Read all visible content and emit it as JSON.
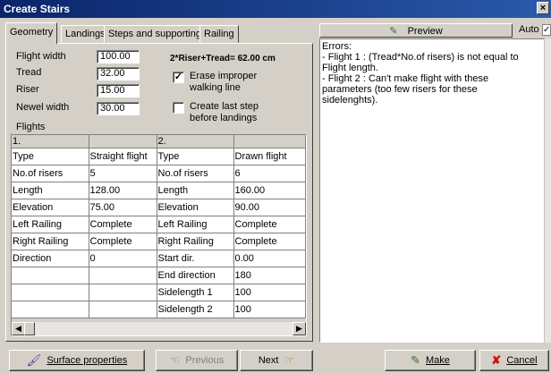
{
  "window": {
    "title": "Create Stairs"
  },
  "tabs": [
    "Geometry",
    "Landings",
    "Steps and supporting",
    "Railing"
  ],
  "geometry": {
    "flight_width_label": "Flight width",
    "flight_width": "100.00",
    "tread_label": "Tread",
    "tread": "32.00",
    "riser_label": "Riser",
    "riser": "15.00",
    "newel_label": "Newel width",
    "newel": "30.00",
    "formula": "2*Riser+Tread= 62.00 cm",
    "erase_label": "Erase improper walking line",
    "erase_checked": true,
    "create_last_label": "Create last step before landings",
    "create_last_checked": false,
    "flights_label": "Flights"
  },
  "flights_grid": {
    "headers": [
      "1.",
      "",
      "2.",
      ""
    ],
    "rows": [
      [
        "Type",
        "Straight flight",
        "Type",
        "Drawn flight"
      ],
      [
        "No.of risers",
        "5",
        "No.of risers",
        "6"
      ],
      [
        "Length",
        "128.00",
        "Length",
        "160.00"
      ],
      [
        "Elevation",
        "75.00",
        "Elevation",
        "90.00"
      ],
      [
        "Left Railing",
        "Complete",
        "Left Railing",
        "Complete"
      ],
      [
        "Right Railing",
        "Complete",
        "Right Railing",
        "Complete"
      ],
      [
        "Direction",
        "0",
        "Start dir.",
        "0.00"
      ],
      [
        "",
        "",
        "End direction",
        "180"
      ],
      [
        "",
        "",
        "Sidelength 1",
        "100"
      ],
      [
        "",
        "",
        "Sidelength 2",
        "100"
      ]
    ]
  },
  "preview": {
    "label": "Preview",
    "auto_label": "Auto"
  },
  "errors": {
    "title": "Errors:",
    "lines": [
      "- Flight 1 : (Tread*No.of risers) is not equal to Flight length.",
      "- Flight 2 : Can't make flight with these parameters (too few risers for these sidelenghts)."
    ]
  },
  "buttons": {
    "surface": "Surface properties",
    "previous": "Previous",
    "next": "Next",
    "make": "Make",
    "cancel": "Cancel"
  }
}
